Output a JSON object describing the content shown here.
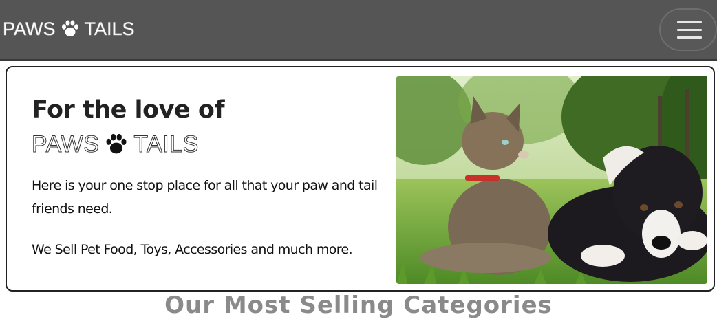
{
  "navbar": {
    "brand_left": "PAWS",
    "brand_right": "TAILS",
    "brand_icon": "paw-icon",
    "menu_icon": "hamburger-menu-icon",
    "background": "#555555"
  },
  "hero": {
    "title": "For the love of",
    "brand_left": "PAWS",
    "brand_right": "TAILS",
    "text_1": "Here is your one stop place for all that your paw and tail friends need.",
    "text_2": "We Sell Pet Food, Toys, Accessories and much more.",
    "image_alt": "cat and puppy lying in grass"
  },
  "section": {
    "heading": "Our Most Selling Categories"
  }
}
